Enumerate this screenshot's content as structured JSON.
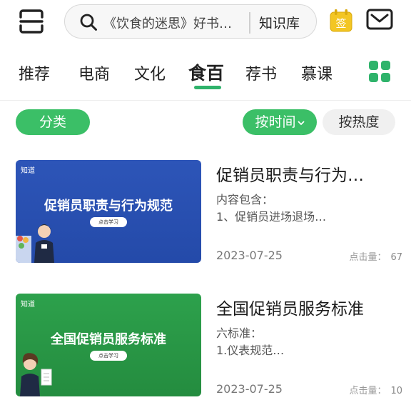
{
  "header": {
    "search_placeholder": "《饮食的迷思》好书…",
    "knowledge_base_label": "知识库",
    "sign_label": "签"
  },
  "tabs": [
    {
      "label": "推荐",
      "active": false
    },
    {
      "label": "电商",
      "active": false
    },
    {
      "label": "文化",
      "active": false
    },
    {
      "label": "食百",
      "active": true
    },
    {
      "label": "荐书",
      "active": false
    },
    {
      "label": "慕课",
      "active": false
    }
  ],
  "filters": {
    "category": "分类",
    "by_time": "按时间",
    "by_heat": "按热度"
  },
  "articles": [
    {
      "thumb_brand": "知道",
      "thumb_title": "促销员职责与行为规范",
      "thumb_button": "点击学习",
      "title": "促销员职责与行为…",
      "desc_line1": "内容包含：",
      "desc_line2": "1、促销员进场退场…",
      "date": "2023-07-25",
      "clicks_label": "点击量：",
      "clicks": "67"
    },
    {
      "thumb_brand": "知道",
      "thumb_title": "全国促销员服务标准",
      "thumb_button": "点击学习",
      "title": "全国促销员服务标准",
      "desc_line1": "六标准：",
      "desc_line2": "1.仪表规范…",
      "date": "2023-07-25",
      "clicks_label": "点击量：",
      "clicks": "10"
    }
  ],
  "colors": {
    "accent": "#3bbf67",
    "thumb_blue": "#2d55b8",
    "thumb_green": "#2da14c",
    "sign_yellow": "#f3c623"
  },
  "icons": [
    "scan-icon",
    "search-icon",
    "sign-in-icon",
    "mail-icon",
    "grid-icon",
    "chevron-down-icon"
  ]
}
